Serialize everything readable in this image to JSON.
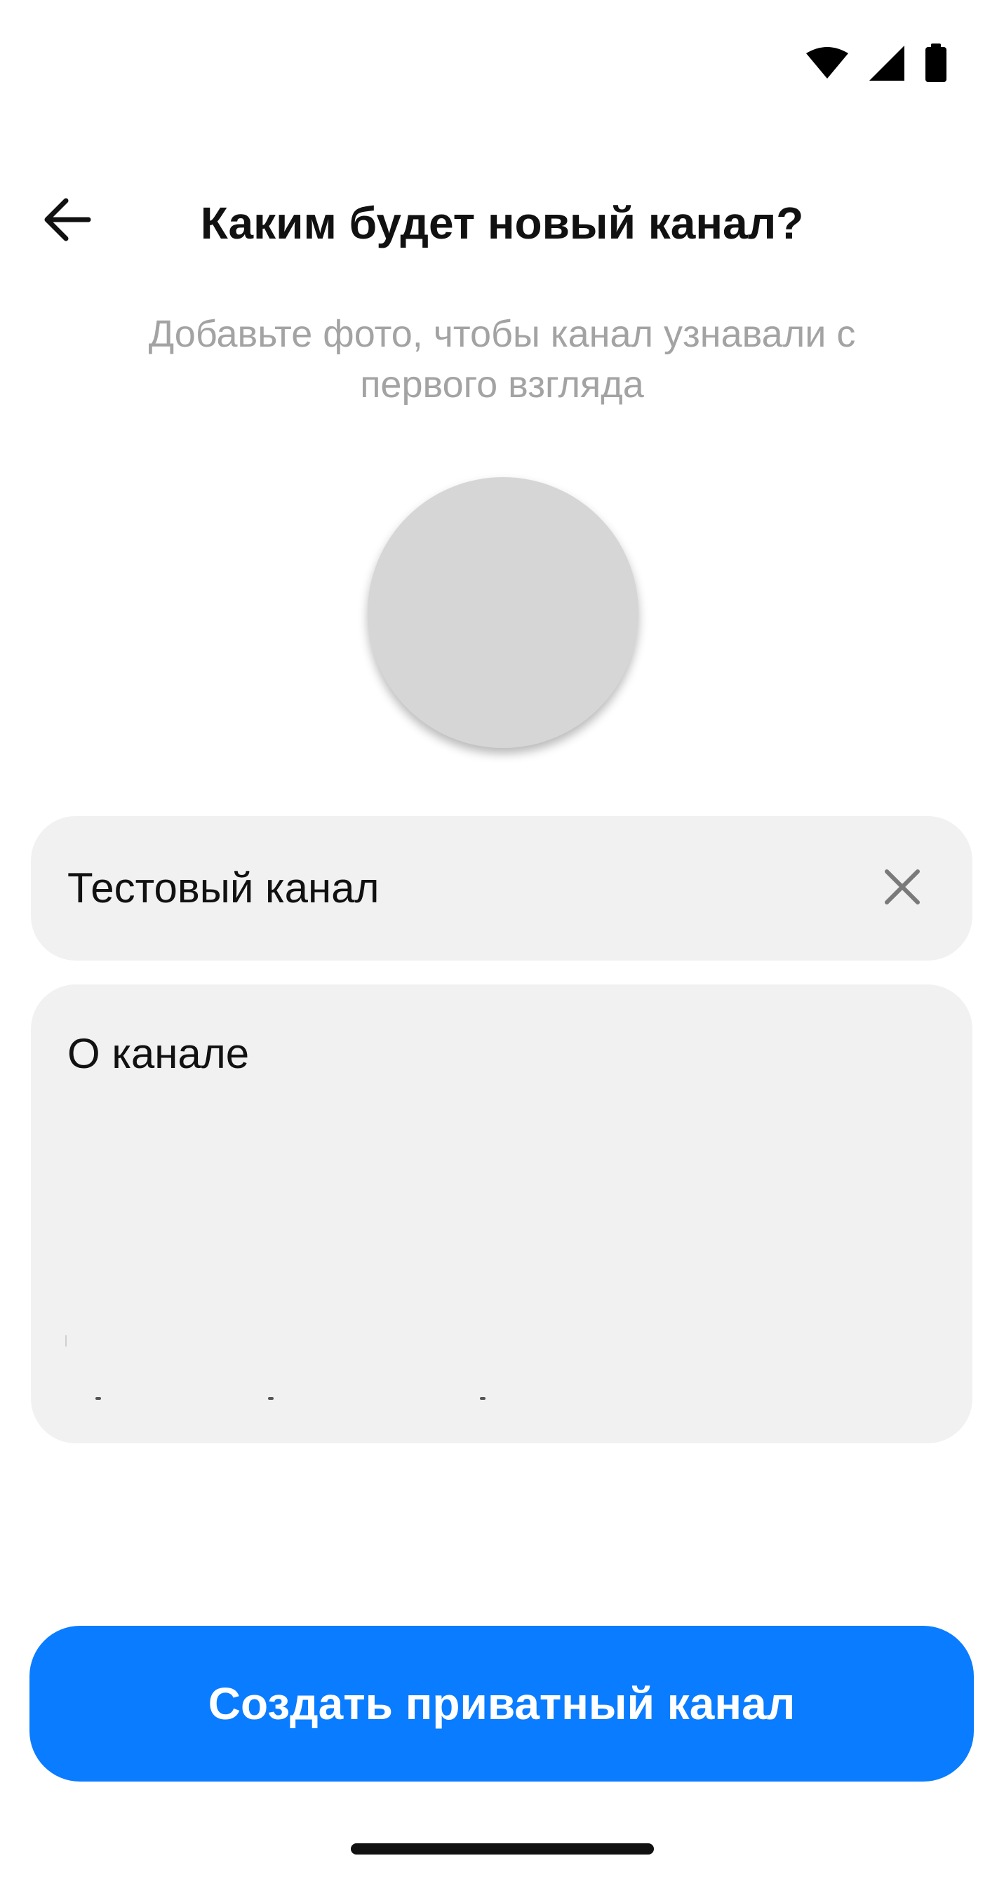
{
  "status_bar": {
    "icons": [
      "wifi-icon",
      "cellular-signal-icon",
      "battery-icon"
    ]
  },
  "header": {
    "back_icon": "arrow-left-icon",
    "title": "Каким будет новый канал?"
  },
  "subtitle": "Добавьте фото, чтобы канал узнавали с первого взгляда",
  "avatar": {
    "color": "#d6d6d6"
  },
  "form": {
    "name_value": "Тестовый канал",
    "clear_icon": "close-icon",
    "about_placeholder": "О канале"
  },
  "primary_button": {
    "label": "Создать приватный канал",
    "color": "#0a7cff"
  }
}
